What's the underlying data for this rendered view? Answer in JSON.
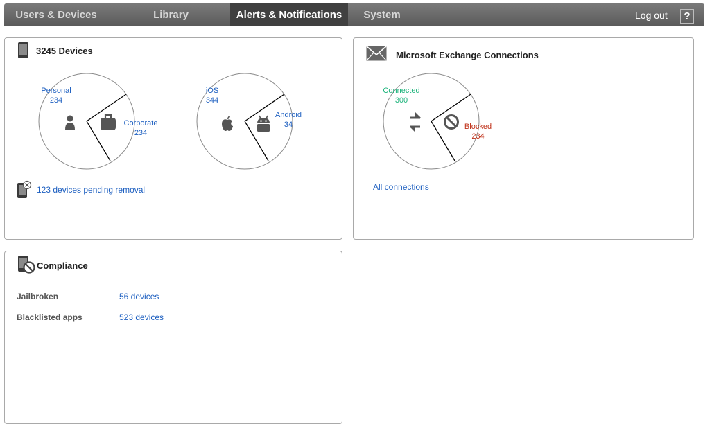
{
  "nav": {
    "tabs": [
      {
        "label": "Users & Devices"
      },
      {
        "label": "Library"
      },
      {
        "label": "Alerts & Notifications"
      },
      {
        "label": "System"
      }
    ],
    "active_tab": "Alerts & Notifications",
    "logout_label": "Log out",
    "help_label": "?"
  },
  "devices_panel": {
    "title": "3245 Devices",
    "icon": "mobile-device-icon",
    "ownership": {
      "personal_label": "Personal",
      "personal_count": "234",
      "corporate_label": "Corporate",
      "corporate_count": "234"
    },
    "platform": {
      "ios_label": "iOS",
      "ios_count": "344",
      "android_label": "Android",
      "android_count": "34"
    },
    "pending_removal_link": "123 devices pending removal"
  },
  "exchange_panel": {
    "title": "Microsoft Exchange Connections",
    "icon": "envelope-icon",
    "connected_label": "Connected",
    "connected_count": "300",
    "blocked_label": "Blocked",
    "blocked_count": "234",
    "all_connections_link": "All connections"
  },
  "compliance_panel": {
    "title": "Compliance",
    "icon": "blocked-device-icon",
    "rows": [
      {
        "label": "Jailbroken",
        "value": "56 devices"
      },
      {
        "label": "Blacklisted apps",
        "value": "523 devices"
      }
    ]
  },
  "colors": {
    "link": "#1d5fc0",
    "connected": "#1bb37a",
    "blocked": "#c0321a",
    "topbar": "#5e5e5e",
    "active_tab": "#404040"
  }
}
